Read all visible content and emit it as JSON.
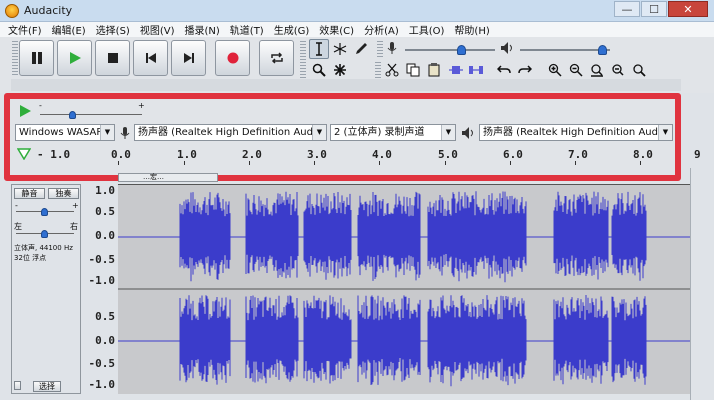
{
  "window": {
    "title": "Audacity",
    "minimize": "—",
    "maximize": "☐",
    "close": "✕"
  },
  "menu": [
    "文件(F)",
    "编辑(E)",
    "选择(S)",
    "视图(V)",
    "播录(N)",
    "轨道(T)",
    "生成(G)",
    "效果(C)",
    "分析(A)",
    "工具(O)",
    "帮助(H)"
  ],
  "transport": {
    "pause": "pause-icon",
    "play": "play-icon",
    "stop": "stop-icon",
    "skip_start": "skip-start-icon",
    "skip_end": "skip-end-icon",
    "record": "record-icon",
    "loop": "loop-icon",
    "play_color": "#2fae3b",
    "record_color": "#e0223a"
  },
  "playmeter": {
    "minus": "-",
    "plus": "+"
  },
  "devices": {
    "host": "Windows WASAPI",
    "recording_device": "扬声器 (Realtek High Definition Audio) (l",
    "channels": "2 (立体声) 录制声道",
    "playback_device": "扬声器 (Realtek High Definition Audio)"
  },
  "ruler": {
    "labels": [
      "- 1.0",
      "0.0",
      "1.0",
      "2.0",
      "3.0",
      "4.0",
      "5.0",
      "6.0",
      "7.0",
      "8.0",
      "9"
    ]
  },
  "track": {
    "mute": "静音",
    "solo": "独奏",
    "gain_minus": "-",
    "gain_plus": "+",
    "pan_left": "左",
    "pan_right": "右",
    "info_line1": "立体声, 44100 Hz",
    "info_line2": "32位 浮点",
    "select": "选择",
    "name_partial": "…宏…"
  },
  "yaxis": {
    "labels": [
      "1.0",
      "0.5",
      "0.0",
      "-0.5",
      "-1.0",
      "0.5",
      "0.0",
      "-0.5",
      "-1.0"
    ]
  },
  "colors": {
    "wave": "#3b3ccb",
    "highlight_box": "#e0333f",
    "waveform_bg": "#c8c9cc"
  }
}
